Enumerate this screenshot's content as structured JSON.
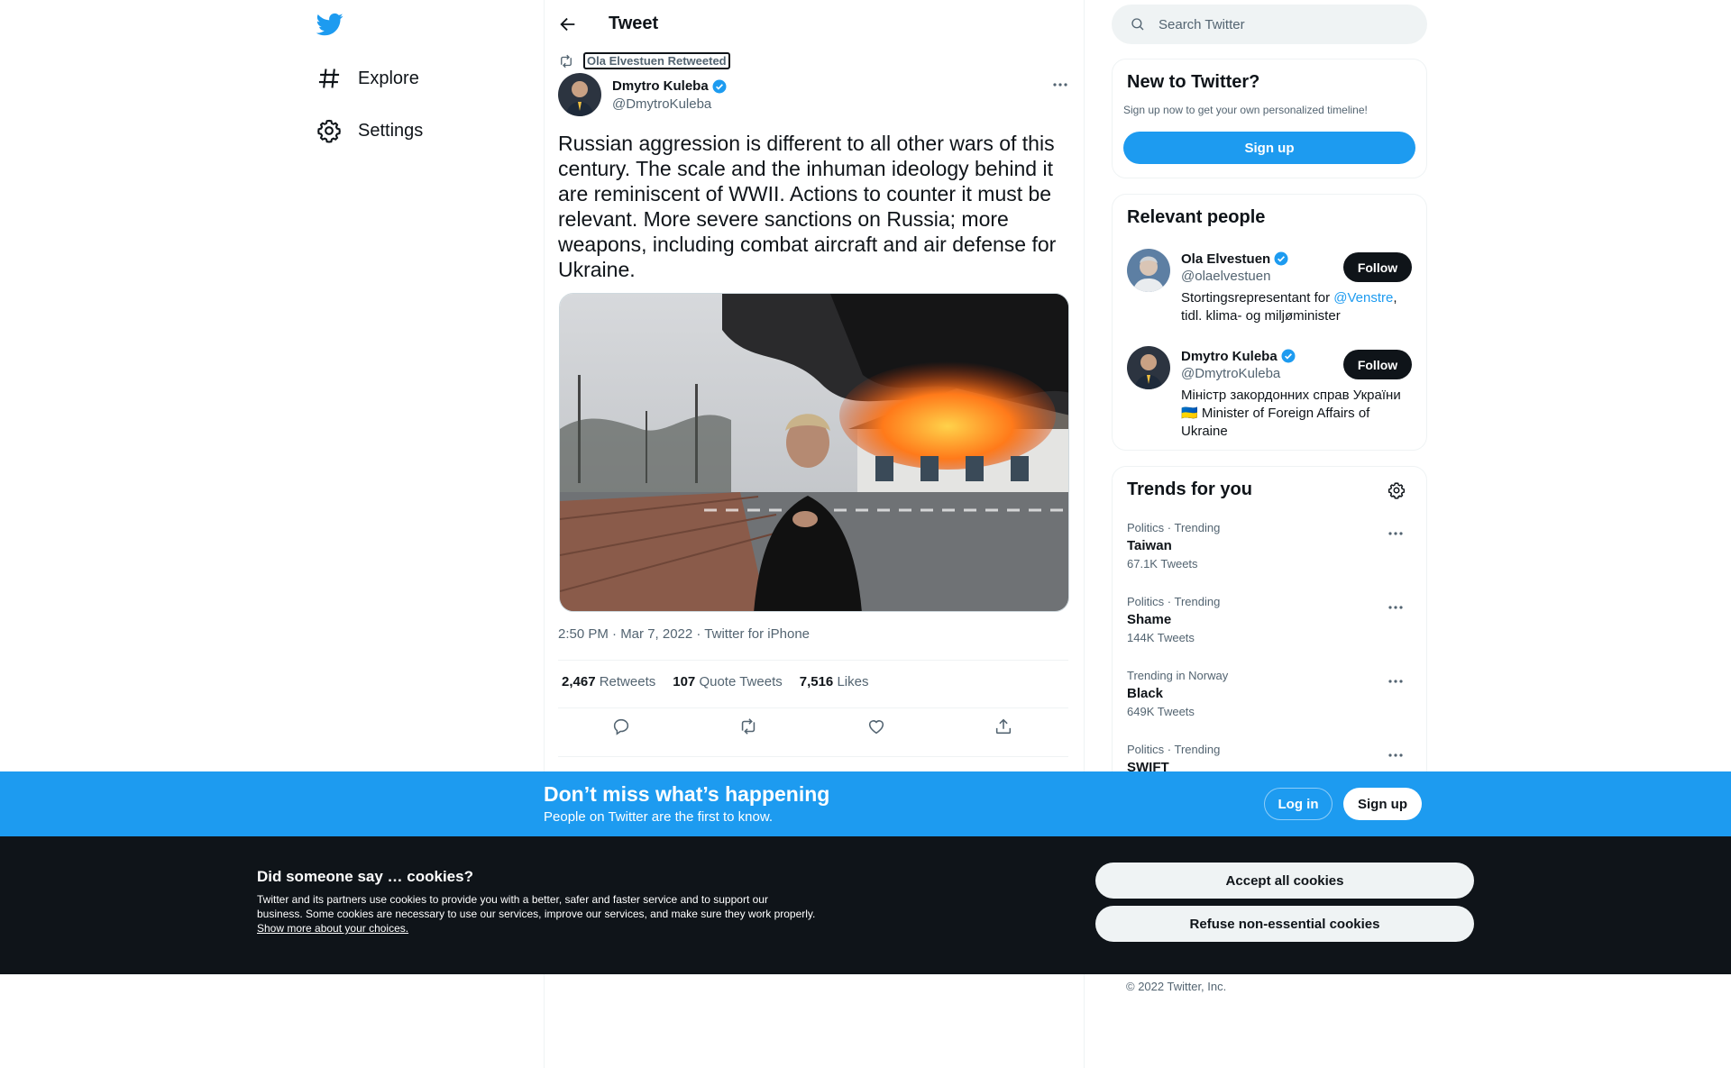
{
  "colors": {
    "accent": "#1d9bf0",
    "text": "#0f1419",
    "muted": "#536471",
    "cookie_bg": "#0f1419"
  },
  "nav": {
    "logo_icon": "twitter-bird-icon",
    "items": [
      {
        "label": "Explore",
        "icon": "hashtag-icon"
      },
      {
        "label": "Settings",
        "icon": "gear-icon"
      }
    ]
  },
  "header": {
    "title": "Tweet",
    "back_icon": "arrow-left-icon"
  },
  "tweet": {
    "retweeted_by": "Ola Elvestuen Retweeted",
    "author_name": "Dmytro Kuleba",
    "author_handle": "@DmytroKuleba",
    "text": "Russian aggression is different to all other wars of this century. The scale and the inhuman ideology behind it are reminiscent of WWII. Actions to counter it must be relevant. More severe sanctions on Russia; more weapons, including combat aircraft and air defense for Ukraine.",
    "timestamp": "2:50 PM · Mar 7, 2022 · Twitter for iPhone",
    "retweets_count": "2,467",
    "retweets_label": "Retweets",
    "quotes_count": "107",
    "quotes_label": "Quote Tweets",
    "likes_count": "7,516",
    "likes_label": "Likes"
  },
  "search": {
    "placeholder": "Search Twitter"
  },
  "new_to_twitter": {
    "title": "New to Twitter?",
    "subtitle": "Sign up now to get your own personalized timeline!",
    "button": "Sign up"
  },
  "relevant_people": {
    "title": "Relevant people",
    "people": [
      {
        "name": "Ola Elvestuen",
        "handle": "@olaelvestuen",
        "bio_prefix": "Stortingsrepresentant for ",
        "bio_link": "@Venstre",
        "bio_suffix": ", tidl. klima- og miljøminister",
        "button": "Follow"
      },
      {
        "name": "Dmytro Kuleba",
        "handle": "@DmytroKuleba",
        "bio_prefix": "Міністр закордонних справ України",
        "bio_flag": "🇺🇦",
        "bio_suffix": " Minister of Foreign Affairs of Ukraine",
        "button": "Follow"
      }
    ]
  },
  "trends": {
    "title": "Trends for you",
    "items": [
      {
        "context": "Politics · Trending",
        "name": "Taiwan",
        "count": "67.1K Tweets"
      },
      {
        "context": "Politics · Trending",
        "name": "Shame",
        "count": "144K Tweets"
      },
      {
        "context": "Trending in Norway",
        "name": "Black",
        "count": "649K Tweets"
      },
      {
        "context": "Politics · Trending",
        "name": "SWIFT",
        "count": ""
      }
    ]
  },
  "bottom_bar": {
    "title": "Don’t miss what’s happening",
    "subtitle": "People on Twitter are the first to know.",
    "login": "Log in",
    "signup": "Sign up"
  },
  "cookies": {
    "title": "Did someone say … cookies?",
    "body": "Twitter and its partners use cookies to provide you with a better, safer and faster service and to support our business. Some cookies are necessary to use our services, improve our services, and make sure they work properly. ",
    "link": "Show more about your choices.",
    "accept": "Accept all cookies",
    "refuse": "Refuse non-essential cookies"
  },
  "footer": {
    "copyright": "© 2022 Twitter, Inc."
  }
}
